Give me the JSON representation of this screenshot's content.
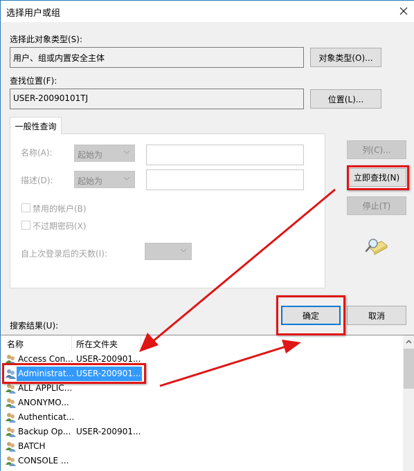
{
  "window": {
    "title": "选择用户或组",
    "close_icon": "close-icon"
  },
  "object_type": {
    "label": "选择此对象类型(S):",
    "value": "用户、组或内置安全主体",
    "button": "对象类型(O)..."
  },
  "location": {
    "label": "查找位置(F):",
    "value": "USER-20090101TJ",
    "button": "位置(L)..."
  },
  "query_tab": {
    "label": "一般性查询",
    "name_label": "名称(A):",
    "name_mode": "起始为",
    "name_value": "",
    "desc_label": "描述(D):",
    "desc_mode": "起始为",
    "desc_value": "",
    "disabled_accounts": {
      "label": "禁用的帐户(B)",
      "checked": false
    },
    "non_expiring": {
      "label": "不过期密码(X)",
      "checked": false
    },
    "days_label": "自上次登录后的天数(I):",
    "days_value": ""
  },
  "side_buttons": {
    "columns": "列(C)...",
    "find_now": "立即查找(N)",
    "stop": "停止(T)",
    "search_icon": "search-magnifier-icon"
  },
  "footer_buttons": {
    "ok": "确定",
    "cancel": "取消"
  },
  "results": {
    "label": "搜索结果(U):",
    "columns": [
      "名称",
      "所在文件夹"
    ],
    "rows": [
      {
        "name": "Access Con...",
        "folder": "USER-200901...",
        "selected": false
      },
      {
        "name": "Administrat...",
        "folder": "USER-200901...",
        "selected": true
      },
      {
        "name": "ALL APPLIC...",
        "folder": "",
        "selected": false
      },
      {
        "name": "ANONYMO...",
        "folder": "",
        "selected": false
      },
      {
        "name": "Authenticat...",
        "folder": "",
        "selected": false
      },
      {
        "name": "Backup Op...",
        "folder": "USER-200901...",
        "selected": false
      },
      {
        "name": "BATCH",
        "folder": "",
        "selected": false
      },
      {
        "name": "CONSOLE ...",
        "folder": "",
        "selected": false
      }
    ]
  },
  "colors": {
    "accent": "#0078d7",
    "selection": "#3399ff",
    "annotation": "#e01515"
  }
}
